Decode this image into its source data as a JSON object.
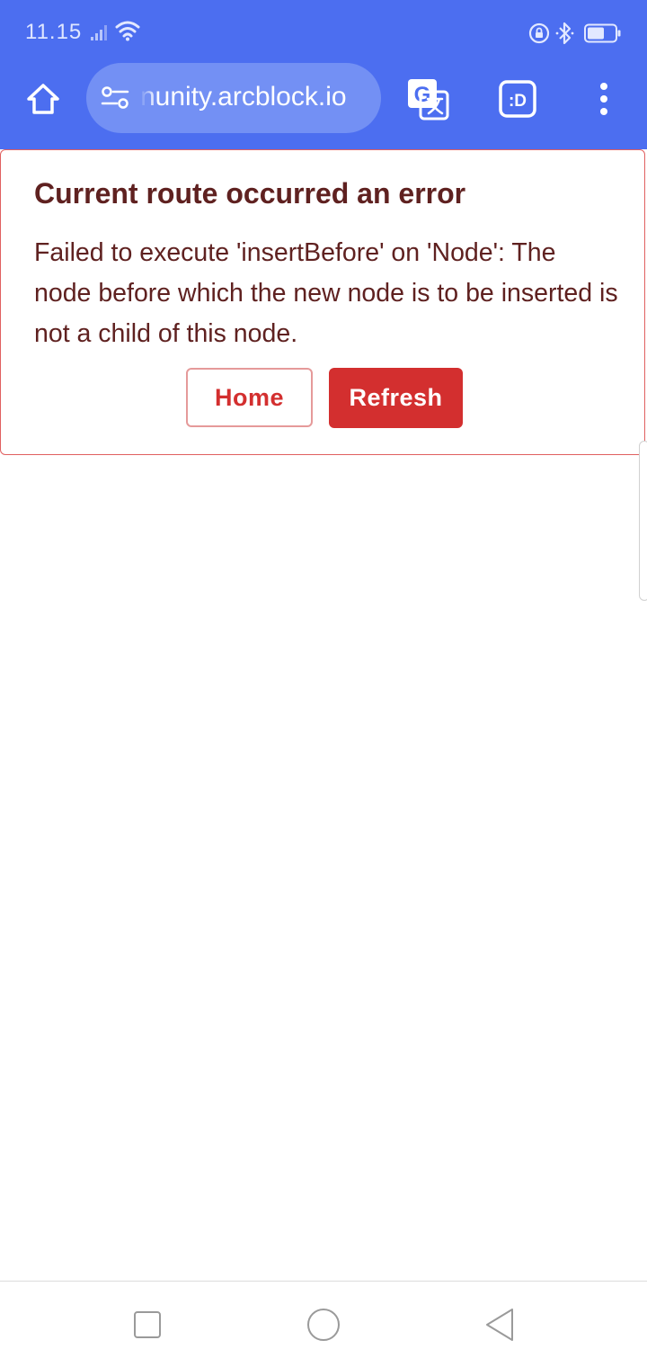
{
  "status_bar": {
    "time": "11.15",
    "icons": [
      "signal-icon",
      "wifi-icon",
      "rotation-lock-icon",
      "bluetooth-icon",
      "battery-icon"
    ]
  },
  "browser": {
    "url_visible": "nunity.arcblock.io",
    "icons": [
      "home-icon",
      "site-settings-icon",
      "translate-icon",
      "extension-icon",
      "more-vert-icon"
    ],
    "toolbar_color": "#4c6ef0"
  },
  "error": {
    "title": "Current route occurred an error",
    "message": "Failed to execute 'insertBefore' on 'Node': The node before which the new node is to be inserted is not a child of this node.",
    "home_label": "Home",
    "refresh_label": "Refresh",
    "accent_color": "#d32f2f",
    "text_color": "#5f2120"
  },
  "nav_bar": {
    "icons": [
      "recents-icon",
      "home-circle-icon",
      "back-icon"
    ]
  }
}
